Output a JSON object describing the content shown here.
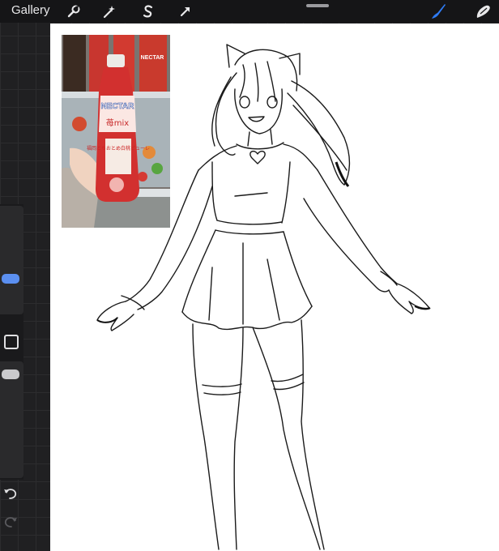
{
  "toolbar": {
    "gallery_label": "Gallery",
    "tools": [
      {
        "name": "wrench-icon"
      },
      {
        "name": "magic-wand-icon"
      },
      {
        "name": "selection-s-icon"
      },
      {
        "name": "transform-arrow-icon"
      }
    ],
    "right_tools": [
      {
        "name": "brush-icon",
        "active": true
      },
      {
        "name": "smudge-icon"
      }
    ],
    "accent_color": "#2f7cf6"
  },
  "sidebar": {
    "brush_size_level": 0.75,
    "opacity_level": 1.0,
    "undo_icon": "undo-icon",
    "redo_icon": "redo-icon"
  },
  "reference_photo": {
    "bottle_brand": "NECTAR",
    "bottle_flavor": "苺mix",
    "bottle_desc": "福岡とちおとめ白桃ピューレ",
    "shelf_brand": "NECTAR"
  },
  "colors": {
    "bottle_red": "#d2302f",
    "canvas": "#ffffff",
    "toolbar": "#151517"
  }
}
